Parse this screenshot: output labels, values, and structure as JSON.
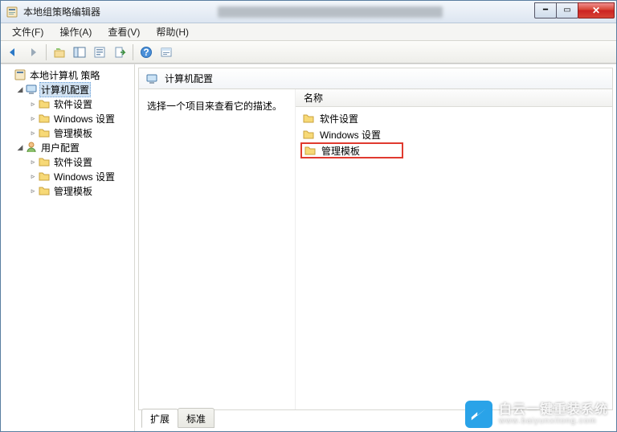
{
  "window": {
    "title": "本地组策略编辑器"
  },
  "menu": {
    "file": "文件(F)",
    "action": "操作(A)",
    "view": "查看(V)",
    "help": "帮助(H)"
  },
  "toolbar": {
    "icons": [
      "back-icon",
      "forward-icon",
      "up-icon",
      "show-tree-icon",
      "properties-icon",
      "export-icon",
      "help-icon",
      "filter-icon"
    ]
  },
  "tree": {
    "root": "本地计算机 策略",
    "computer": "计算机配置",
    "user": "用户配置",
    "children": {
      "software": "软件设置",
      "windows": "Windows 设置",
      "admin": "管理模板"
    }
  },
  "detail": {
    "header": "计算机配置",
    "desc": "选择一个项目来查看它的描述。",
    "col_name": "名称",
    "items": [
      {
        "label": "软件设置",
        "hl": false
      },
      {
        "label": "Windows 设置",
        "hl": false
      },
      {
        "label": "管理模板",
        "hl": true
      }
    ]
  },
  "tabs": {
    "extended": "扩展",
    "standard": "标准"
  },
  "watermark": {
    "cn": "白云一键重装系统",
    "en": "www.baiyunxitong.com"
  },
  "colors": {
    "highlight_border": "#e03a2f",
    "selection_bg": "#d1e2f2"
  }
}
